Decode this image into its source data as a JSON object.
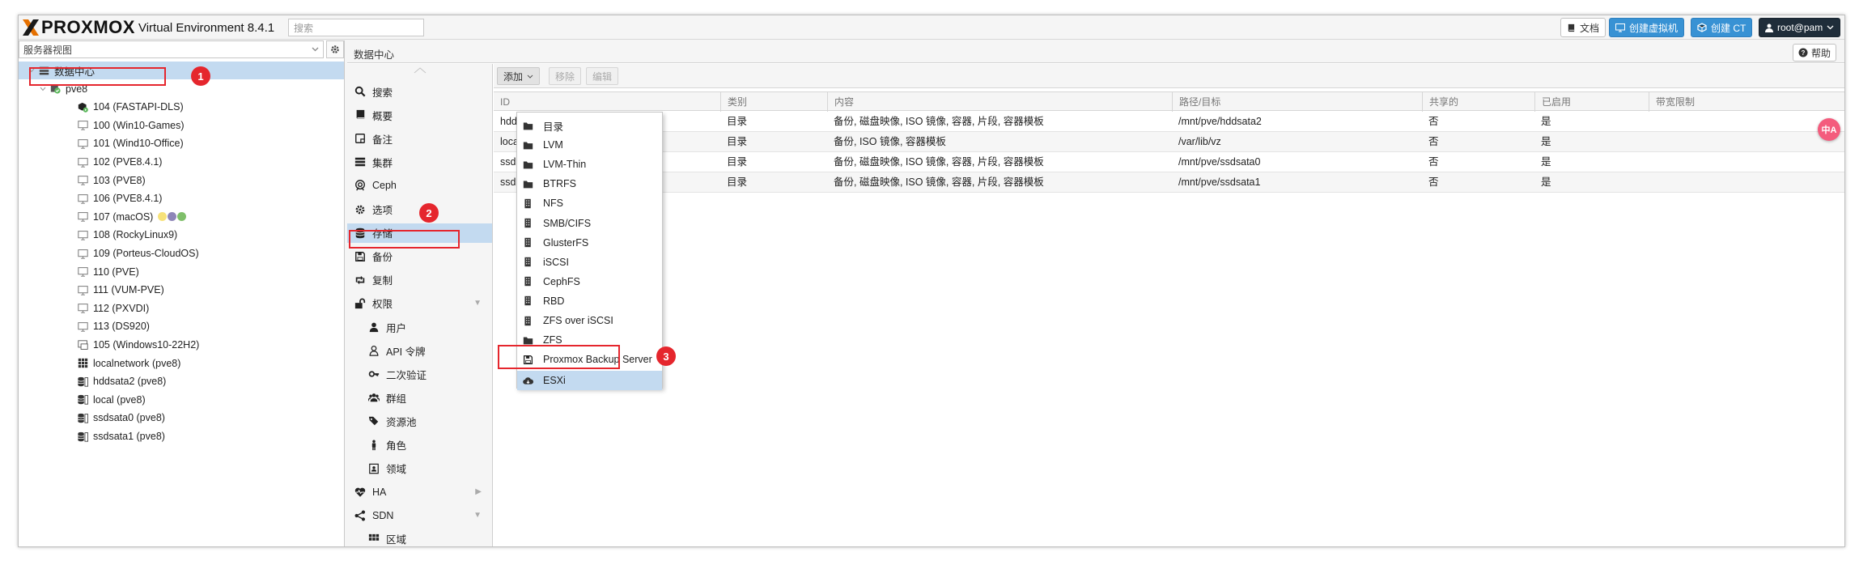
{
  "topbar": {
    "brand": "PROXMOX",
    "version": "Virtual Environment 8.4.1",
    "search_placeholder": "搜索",
    "docs_label": "文档",
    "create_vm_label": "创建虚拟机",
    "create_ct_label": "创建 CT",
    "user_label": "root@pam"
  },
  "left": {
    "view_select": "服务器视图",
    "tree": [
      {
        "label": "数据中心",
        "icon": "datacenter-icon"
      },
      {
        "label": "pve8",
        "icon": "node-online-icon"
      },
      {
        "label": "104 (FASTAPI-DLS)",
        "icon": "container-running-icon"
      },
      {
        "label": "100 (Win10-Games)",
        "icon": "vm-icon"
      },
      {
        "label": "101 (Wind10-Office)",
        "icon": "vm-icon"
      },
      {
        "label": "102 (PVE8.4.1)",
        "icon": "vm-icon"
      },
      {
        "label": "103 (PVE8)",
        "icon": "vm-icon"
      },
      {
        "label": "106 (PVE8.4.1)",
        "icon": "vm-icon"
      },
      {
        "label": "107 (macOS)",
        "icon": "vm-icon"
      },
      {
        "label": "108 (RockyLinux9)",
        "icon": "vm-icon"
      },
      {
        "label": "109 (Porteus-CloudOS)",
        "icon": "vm-icon"
      },
      {
        "label": "110 (PVE)",
        "icon": "vm-icon"
      },
      {
        "label": "111 (VUM-PVE)",
        "icon": "vm-icon"
      },
      {
        "label": "112 (PXVDI)",
        "icon": "vm-icon"
      },
      {
        "label": "113 (DS920)",
        "icon": "vm-icon"
      },
      {
        "label": "105 (Windows10-22H2)",
        "icon": "template-icon"
      },
      {
        "label": "localnetwork (pve8)",
        "icon": "network-grid-icon"
      },
      {
        "label": "hddsata2 (pve8)",
        "icon": "storage-icon"
      },
      {
        "label": "local (pve8)",
        "icon": "storage-icon"
      },
      {
        "label": "ssdsata0 (pve8)",
        "icon": "storage-icon"
      },
      {
        "label": "ssdsata1 (pve8)",
        "icon": "storage-icon"
      }
    ],
    "tag_colors": [
      "#f7e27a",
      "#8e86b8",
      "#7fbf6a"
    ]
  },
  "right": {
    "title": "数据中心",
    "help_label": "帮助",
    "menu": [
      {
        "label": "搜索",
        "icon": "search-icon"
      },
      {
        "label": "概要",
        "icon": "book-icon"
      },
      {
        "label": "备注",
        "icon": "note-icon"
      },
      {
        "label": "集群",
        "icon": "server-icon"
      },
      {
        "label": "Ceph",
        "icon": "ceph-icon"
      },
      {
        "label": "选项",
        "icon": "gear-icon"
      },
      {
        "label": "存储",
        "icon": "database-icon"
      },
      {
        "label": "备份",
        "icon": "floppy-icon"
      },
      {
        "label": "复制",
        "icon": "retweet-icon"
      },
      {
        "label": "权限",
        "icon": "unlock-icon"
      },
      {
        "label": "用户",
        "icon": "user-icon"
      },
      {
        "label": "API 令牌",
        "icon": "user-outline-icon"
      },
      {
        "label": "二次验证",
        "icon": "key-icon"
      },
      {
        "label": "群组",
        "icon": "users-icon"
      },
      {
        "label": "资源池",
        "icon": "tags-icon"
      },
      {
        "label": "角色",
        "icon": "male-icon"
      },
      {
        "label": "领域",
        "icon": "id-card-icon"
      },
      {
        "label": "HA",
        "icon": "heartbeat-icon"
      },
      {
        "label": "SDN",
        "icon": "sdn-icon"
      },
      {
        "label": "区域",
        "icon": "zone-grid-icon"
      }
    ],
    "toolbar": {
      "add": "添加",
      "remove": "移除",
      "edit": "编辑"
    },
    "columns": [
      "ID",
      "类别",
      "内容",
      "路径/目标",
      "共享的",
      "已启用",
      "带宽限制"
    ],
    "rows": [
      {
        "id": "hddsata2",
        "type": "目录",
        "content": "备份, 磁盘映像, ISO 镜像, 容器, 片段, 容器模板",
        "path": "/mnt/pve/hddsata2",
        "shared": "否",
        "enabled": "是",
        "bw": ""
      },
      {
        "id": "local",
        "type": "目录",
        "content": "备份, ISO 镜像, 容器模板",
        "path": "/var/lib/vz",
        "shared": "否",
        "enabled": "是",
        "bw": ""
      },
      {
        "id": "ssdsata0",
        "type": "目录",
        "content": "备份, 磁盘映像, ISO 镜像, 容器, 片段, 容器模板",
        "path": "/mnt/pve/ssdsata0",
        "shared": "否",
        "enabled": "是",
        "bw": ""
      },
      {
        "id": "ssdsata1",
        "type": "目录",
        "content": "备份, 磁盘映像, ISO 镜像, 容器, 片段, 容器模板",
        "path": "/mnt/pve/ssdsata1",
        "shared": "否",
        "enabled": "是",
        "bw": ""
      }
    ],
    "add_menu": [
      {
        "label": "目录",
        "icon": "folder-icon"
      },
      {
        "label": "LVM",
        "icon": "folder-icon"
      },
      {
        "label": "LVM-Thin",
        "icon": "folder-icon"
      },
      {
        "label": "BTRFS",
        "icon": "folder-icon"
      },
      {
        "label": "NFS",
        "icon": "building-icon"
      },
      {
        "label": "SMB/CIFS",
        "icon": "building-icon"
      },
      {
        "label": "GlusterFS",
        "icon": "building-icon"
      },
      {
        "label": "iSCSI",
        "icon": "building-icon"
      },
      {
        "label": "CephFS",
        "icon": "building-icon"
      },
      {
        "label": "RBD",
        "icon": "building-icon"
      },
      {
        "label": "ZFS over iSCSI",
        "icon": "building-icon"
      },
      {
        "label": "ZFS",
        "icon": "folder-icon"
      },
      {
        "label": "Proxmox Backup Server",
        "icon": "floppy-icon"
      },
      {
        "label": "ESXi",
        "icon": "cloud-download-icon"
      }
    ]
  },
  "annotations": {
    "m1": "1",
    "m2": "2",
    "m3": "3"
  },
  "translate_badge": "中A",
  "colors": {
    "accent": "#3892d4",
    "selection": "#c3daf0",
    "annotation": "#e5262d",
    "running": "#5cb85c"
  }
}
